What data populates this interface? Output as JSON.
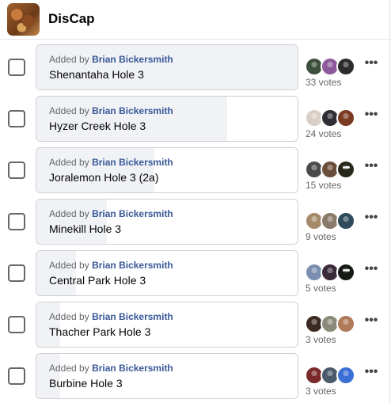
{
  "group": {
    "name": "DisCap"
  },
  "added_prefix": "Added by",
  "more_dots": "•••",
  "menu_dots": "•••",
  "options": [
    {
      "label": "Shenantaha Hole 3",
      "added_by": "Brian Bickersmith",
      "votes": "33 votes",
      "vote_count": 33,
      "share": 1.0,
      "avatars": [
        "#3b4f3a",
        "#8c5a9a",
        "#2b2b2b"
      ],
      "more_overlay": false
    },
    {
      "label": "Hyzer Creek Hole 3",
      "added_by": "Brian Bickersmith",
      "votes": "24 votes",
      "vote_count": 24,
      "share": 0.73,
      "avatars": [
        "#d9cfc4",
        "#2e2e35",
        "#7a3b22"
      ],
      "more_overlay": false
    },
    {
      "label": "Joralemon Hole 3 (2a)",
      "added_by": "Brian Bickersmith",
      "votes": "15 votes",
      "vote_count": 15,
      "share": 0.45,
      "avatars": [
        "#4a4a4a",
        "#6b4e3a",
        "#5a5a3a"
      ],
      "more_overlay": true
    },
    {
      "label": "Minekill Hole 3",
      "added_by": "Brian Bickersmith",
      "votes": "9 votes",
      "vote_count": 9,
      "share": 0.27,
      "avatars": [
        "#a58a6a",
        "#8a7a6a",
        "#2f4a5a"
      ],
      "more_overlay": false
    },
    {
      "label": "Central Park Hole 3",
      "added_by": "Brian Bickersmith",
      "votes": "5 votes",
      "vote_count": 5,
      "share": 0.15,
      "avatars": [
        "#7a8fb0",
        "#3a2a3a",
        "#2f3a2f"
      ],
      "more_overlay": true
    },
    {
      "label": "Thacher Park Hole 3",
      "added_by": "Brian Bickersmith",
      "votes": "3 votes",
      "vote_count": 3,
      "share": 0.09,
      "avatars": [
        "#3a2a22",
        "#8a8a7a",
        "#b07a5a"
      ],
      "more_overlay": false
    },
    {
      "label": "Burbine Hole 3",
      "added_by": "Brian Bickersmith",
      "votes": "3 votes",
      "vote_count": 3,
      "share": 0.09,
      "avatars": [
        "#7a2a2a",
        "#4a5a6a",
        "#3b6fd6"
      ],
      "more_overlay": false
    }
  ]
}
